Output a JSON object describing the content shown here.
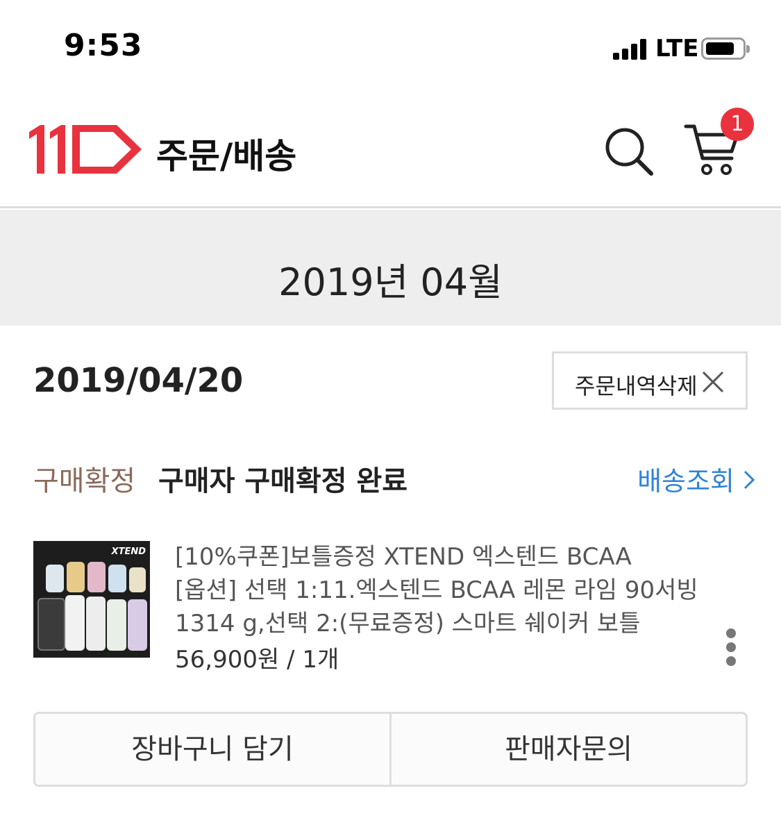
{
  "status_bar": {
    "time": "9:53",
    "network": "LTE",
    "signal_icon": "signal-bars-icon",
    "battery_icon": "battery-icon"
  },
  "header": {
    "logo_icon": "11st-logo",
    "title": "주문/배송",
    "search_icon": "search-icon",
    "cart_icon": "cart-icon",
    "cart_count": "1",
    "colors": {
      "brand": "#e8333f",
      "badge": "#e8333f"
    }
  },
  "month": "2019년 04월",
  "order": {
    "date": "2019/04/20",
    "delete_label": "주문내역삭제",
    "status_label": "구매확정",
    "status_text": "구매자 구매확정 완료",
    "track_label": "배송조회",
    "product": {
      "thumbnail_brand": "XTEND",
      "name_line1": "[10%쿠폰]보틀증정 XTEND 엑스텐드 BCAA",
      "name_line2": "[옵션] 선택 1:11.엑스텐드 BCAA 레몬 라임 90서빙",
      "name_line3": "1314 g,선택 2:(무료증정) 스마트 쉐이커 보틀",
      "price": "56,900원 / 1개"
    },
    "actions": {
      "add_to_cart": "장바구니 담기",
      "ask_seller": "판매자문의"
    },
    "colors": {
      "status": "#8a6b5c",
      "link": "#2f83d8"
    }
  }
}
